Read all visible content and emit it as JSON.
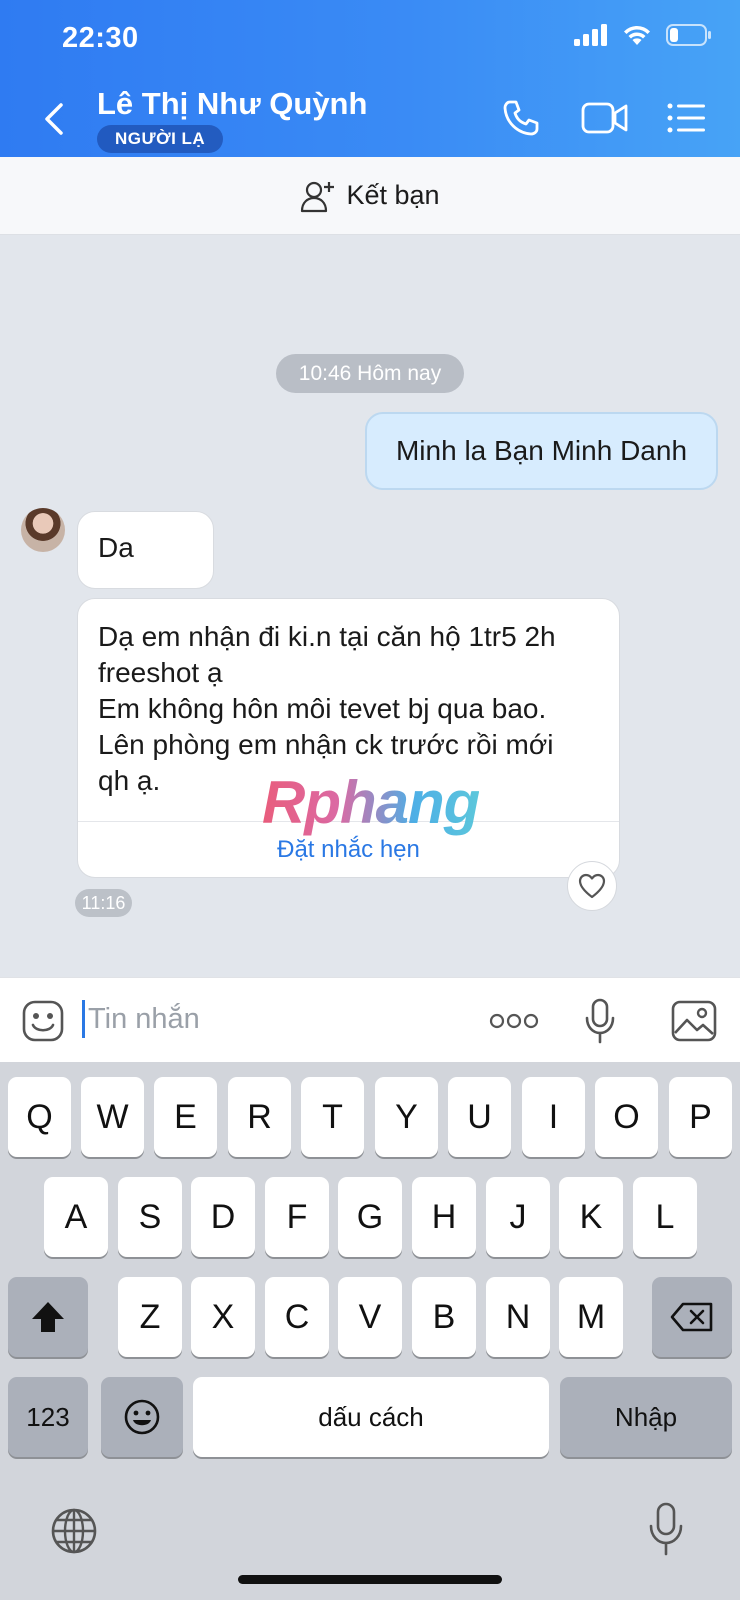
{
  "status_bar": {
    "time": "22:30"
  },
  "header": {
    "back_icon": "chevron-left-icon",
    "contact_name": "Lê Thị Như Quỳnh",
    "badge": "NGƯỜI LẠ",
    "icons": [
      "phone-icon",
      "video-icon",
      "menu-list-icon"
    ]
  },
  "friend_bar": {
    "icon": "add-user-icon",
    "label": "Kết bạn"
  },
  "chat": {
    "date_pill": "10:46 Hôm nay",
    "outgoing": [
      {
        "text": "Minh la Bạn Minh Danh"
      }
    ],
    "incoming": [
      {
        "text": "Da"
      },
      {
        "lines": [
          "Dạ em nhận đi ki.n tại căn hộ 1tr5 2h",
          "freeshot ạ",
          "Em không hôn môi tevet bj qua bao.",
          "Lên phòng em nhận ck trước rồi mới",
          "qh ạ."
        ],
        "action": "Đặt nhắc hẹn",
        "time": "11:16"
      }
    ],
    "watermark": "Rphang"
  },
  "input_bar": {
    "placeholder": "Tin nhắn",
    "icons": [
      "sticker-icon",
      "more-dots-icon",
      "microphone-icon",
      "image-icon"
    ]
  },
  "keyboard": {
    "row1": [
      "Q",
      "W",
      "E",
      "R",
      "T",
      "Y",
      "U",
      "I",
      "O",
      "P"
    ],
    "row2": [
      "A",
      "S",
      "D",
      "F",
      "G",
      "H",
      "J",
      "K",
      "L"
    ],
    "row3": [
      "Z",
      "X",
      "C",
      "V",
      "B",
      "N",
      "M"
    ],
    "numbers_key": "123",
    "space_key": "dấu cách",
    "return_key": "Nhập"
  },
  "colors": {
    "header_start": "#2f7bf2",
    "header_end": "#47a3f6",
    "outgoing_bubble": "#d7ecfe",
    "link": "#2a78e4"
  }
}
